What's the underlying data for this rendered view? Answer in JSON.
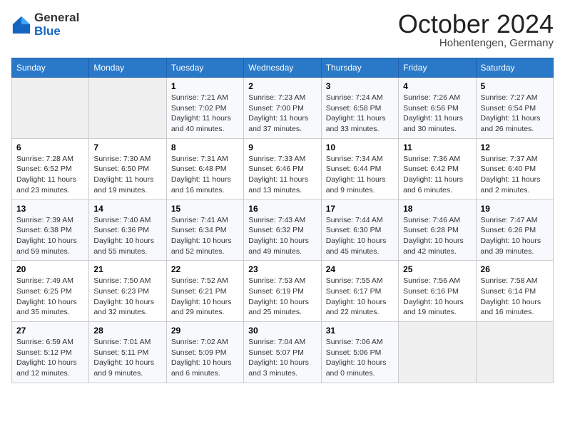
{
  "header": {
    "logo_general": "General",
    "logo_blue": "Blue",
    "month_title": "October 2024",
    "location": "Hohentengen, Germany"
  },
  "days_of_week": [
    "Sunday",
    "Monday",
    "Tuesday",
    "Wednesday",
    "Thursday",
    "Friday",
    "Saturday"
  ],
  "weeks": [
    [
      {
        "day": "",
        "info": ""
      },
      {
        "day": "",
        "info": ""
      },
      {
        "day": "1",
        "info": "Sunrise: 7:21 AM\nSunset: 7:02 PM\nDaylight: 11 hours and 40 minutes."
      },
      {
        "day": "2",
        "info": "Sunrise: 7:23 AM\nSunset: 7:00 PM\nDaylight: 11 hours and 37 minutes."
      },
      {
        "day": "3",
        "info": "Sunrise: 7:24 AM\nSunset: 6:58 PM\nDaylight: 11 hours and 33 minutes."
      },
      {
        "day": "4",
        "info": "Sunrise: 7:26 AM\nSunset: 6:56 PM\nDaylight: 11 hours and 30 minutes."
      },
      {
        "day": "5",
        "info": "Sunrise: 7:27 AM\nSunset: 6:54 PM\nDaylight: 11 hours and 26 minutes."
      }
    ],
    [
      {
        "day": "6",
        "info": "Sunrise: 7:28 AM\nSunset: 6:52 PM\nDaylight: 11 hours and 23 minutes."
      },
      {
        "day": "7",
        "info": "Sunrise: 7:30 AM\nSunset: 6:50 PM\nDaylight: 11 hours and 19 minutes."
      },
      {
        "day": "8",
        "info": "Sunrise: 7:31 AM\nSunset: 6:48 PM\nDaylight: 11 hours and 16 minutes."
      },
      {
        "day": "9",
        "info": "Sunrise: 7:33 AM\nSunset: 6:46 PM\nDaylight: 11 hours and 13 minutes."
      },
      {
        "day": "10",
        "info": "Sunrise: 7:34 AM\nSunset: 6:44 PM\nDaylight: 11 hours and 9 minutes."
      },
      {
        "day": "11",
        "info": "Sunrise: 7:36 AM\nSunset: 6:42 PM\nDaylight: 11 hours and 6 minutes."
      },
      {
        "day": "12",
        "info": "Sunrise: 7:37 AM\nSunset: 6:40 PM\nDaylight: 11 hours and 2 minutes."
      }
    ],
    [
      {
        "day": "13",
        "info": "Sunrise: 7:39 AM\nSunset: 6:38 PM\nDaylight: 10 hours and 59 minutes."
      },
      {
        "day": "14",
        "info": "Sunrise: 7:40 AM\nSunset: 6:36 PM\nDaylight: 10 hours and 55 minutes."
      },
      {
        "day": "15",
        "info": "Sunrise: 7:41 AM\nSunset: 6:34 PM\nDaylight: 10 hours and 52 minutes."
      },
      {
        "day": "16",
        "info": "Sunrise: 7:43 AM\nSunset: 6:32 PM\nDaylight: 10 hours and 49 minutes."
      },
      {
        "day": "17",
        "info": "Sunrise: 7:44 AM\nSunset: 6:30 PM\nDaylight: 10 hours and 45 minutes."
      },
      {
        "day": "18",
        "info": "Sunrise: 7:46 AM\nSunset: 6:28 PM\nDaylight: 10 hours and 42 minutes."
      },
      {
        "day": "19",
        "info": "Sunrise: 7:47 AM\nSunset: 6:26 PM\nDaylight: 10 hours and 39 minutes."
      }
    ],
    [
      {
        "day": "20",
        "info": "Sunrise: 7:49 AM\nSunset: 6:25 PM\nDaylight: 10 hours and 35 minutes."
      },
      {
        "day": "21",
        "info": "Sunrise: 7:50 AM\nSunset: 6:23 PM\nDaylight: 10 hours and 32 minutes."
      },
      {
        "day": "22",
        "info": "Sunrise: 7:52 AM\nSunset: 6:21 PM\nDaylight: 10 hours and 29 minutes."
      },
      {
        "day": "23",
        "info": "Sunrise: 7:53 AM\nSunset: 6:19 PM\nDaylight: 10 hours and 25 minutes."
      },
      {
        "day": "24",
        "info": "Sunrise: 7:55 AM\nSunset: 6:17 PM\nDaylight: 10 hours and 22 minutes."
      },
      {
        "day": "25",
        "info": "Sunrise: 7:56 AM\nSunset: 6:16 PM\nDaylight: 10 hours and 19 minutes."
      },
      {
        "day": "26",
        "info": "Sunrise: 7:58 AM\nSunset: 6:14 PM\nDaylight: 10 hours and 16 minutes."
      }
    ],
    [
      {
        "day": "27",
        "info": "Sunrise: 6:59 AM\nSunset: 5:12 PM\nDaylight: 10 hours and 12 minutes."
      },
      {
        "day": "28",
        "info": "Sunrise: 7:01 AM\nSunset: 5:11 PM\nDaylight: 10 hours and 9 minutes."
      },
      {
        "day": "29",
        "info": "Sunrise: 7:02 AM\nSunset: 5:09 PM\nDaylight: 10 hours and 6 minutes."
      },
      {
        "day": "30",
        "info": "Sunrise: 7:04 AM\nSunset: 5:07 PM\nDaylight: 10 hours and 3 minutes."
      },
      {
        "day": "31",
        "info": "Sunrise: 7:06 AM\nSunset: 5:06 PM\nDaylight: 10 hours and 0 minutes."
      },
      {
        "day": "",
        "info": ""
      },
      {
        "day": "",
        "info": ""
      }
    ]
  ]
}
